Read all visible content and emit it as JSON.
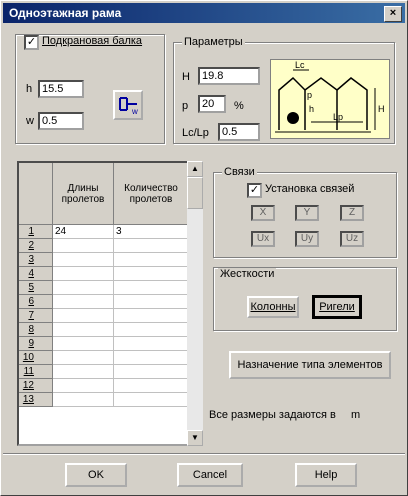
{
  "window": {
    "title": "Одноэтажная рама",
    "close_glyph": "×"
  },
  "crane_group": {
    "checkbox_label": "Подкрановая балка",
    "checked": true,
    "h_label": "h",
    "h_value": "15.5",
    "w_label": "w",
    "w_value": "0.5"
  },
  "params_group": {
    "legend": "Параметры",
    "H_label": "H",
    "H_value": "19.8",
    "p_label": "p",
    "p_value": "20",
    "percent": "%",
    "ratio_label": "Lc/Lp",
    "ratio_value": "0.5",
    "diagram": {
      "Lc": "Lc",
      "p": "p",
      "h": "h",
      "H": "H",
      "Lp": "Lp"
    }
  },
  "grid": {
    "col_headers": [
      "Длины пролетов",
      "Количество пролетов"
    ],
    "rows": [
      {
        "num": "1",
        "len": "24",
        "count": "3"
      },
      {
        "num": "2",
        "len": "",
        "count": ""
      },
      {
        "num": "3",
        "len": "",
        "count": ""
      },
      {
        "num": "4",
        "len": "",
        "count": ""
      },
      {
        "num": "5",
        "len": "",
        "count": ""
      },
      {
        "num": "6",
        "len": "",
        "count": ""
      },
      {
        "num": "7",
        "len": "",
        "count": ""
      },
      {
        "num": "8",
        "len": "",
        "count": ""
      },
      {
        "num": "9",
        "len": "",
        "count": ""
      },
      {
        "num": "10",
        "len": "",
        "count": ""
      },
      {
        "num": "11",
        "len": "",
        "count": ""
      },
      {
        "num": "12",
        "len": "",
        "count": ""
      },
      {
        "num": "13",
        "len": "",
        "count": ""
      }
    ]
  },
  "links_group": {
    "legend": "Связи",
    "checkbox_label": "Установка связей",
    "checked": true,
    "axes": [
      "X",
      "Y",
      "Z",
      "Ux",
      "Uy",
      "Uz"
    ]
  },
  "stiffness_group": {
    "legend": "Жесткости",
    "columns_button": "Колонны",
    "beams_button": "Ригели"
  },
  "assign_button": "Назначение типа элементов",
  "units_note": "Все размеры задаются в",
  "units_value": "m",
  "footer": {
    "ok": "OK",
    "cancel": "Cancel",
    "help": "Help"
  }
}
